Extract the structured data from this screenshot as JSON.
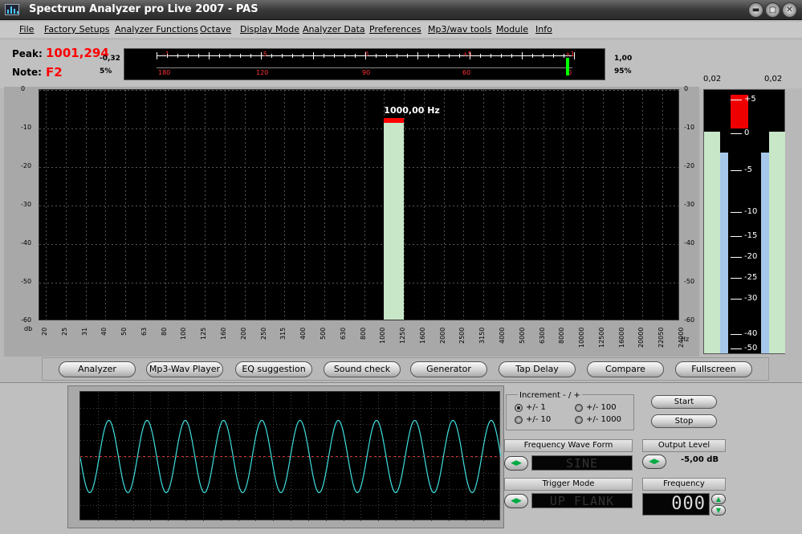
{
  "window": {
    "title": "Spectrum Analyzer pro Live 2007 - PAS",
    "controls": {
      "minimize": "▬",
      "restore": "▢",
      "close": "✕"
    }
  },
  "menu": [
    "File",
    "Factory Setups",
    "Analyzer Functions",
    "Octave",
    "Display Mode",
    "Analyzer Data",
    "Preferences",
    "Mp3/wav tools",
    "Module",
    "Info"
  ],
  "readout": {
    "peak_label": "Peak:",
    "peak_value": "1001,294",
    "note_label": "Note:",
    "note_value": "F2",
    "left_top": "-0,32",
    "left_bottom": "5%",
    "right_top": "1,00",
    "right_bottom": "95%"
  },
  "tuner": {
    "top_ticks": [
      "-1",
      "-5",
      "0",
      "+5",
      "+1"
    ],
    "bottom_ticks": [
      "180",
      "120",
      "90",
      "60",
      "0"
    ],
    "needle_fraction": 0.92
  },
  "spectrum": {
    "y_ticks": [
      "0",
      "-10",
      "-20",
      "-30",
      "-40",
      "-50",
      "-60"
    ],
    "y_unit": "db",
    "x_unit": "Hz",
    "x_ticks": [
      "20",
      "25",
      "31",
      "40",
      "50",
      "63",
      "80",
      "100",
      "125",
      "160",
      "200",
      "250",
      "315",
      "400",
      "500",
      "630",
      "800",
      "1000",
      "1250",
      "1600",
      "2000",
      "2500",
      "3150",
      "4000",
      "5000",
      "6300",
      "8000",
      "10000",
      "12500",
      "16000",
      "20000",
      "22050",
      "24000"
    ],
    "peak_label": "1000,00 Hz",
    "peak_db": -8.5
  },
  "vu": {
    "left_label": "0,02",
    "right_label": "0,02",
    "scale": [
      "+5",
      "0",
      "-5",
      "-10",
      "-15",
      "-20",
      "-25",
      "-30",
      "-40",
      "-50"
    ]
  },
  "buttons": [
    "Analyzer",
    "Mp3-Wav Player",
    "EQ suggestion",
    "Sound check",
    "Generator",
    "Tap Delay",
    "Compare",
    "Fullscreen"
  ],
  "generator": {
    "increment_title": "Increment - / +",
    "increments": [
      "+/- 1",
      "+/- 10",
      "+/- 100",
      "+/- 1000"
    ],
    "start": "Start",
    "stop": "Stop",
    "wave_form_title": "Frequency Wave Form",
    "wave_form": "SINE",
    "output_title": "Output Level",
    "output_value": "-5,00 dB",
    "trigger_title": "Trigger Mode",
    "trigger": "UP FLANK",
    "frequency_title": "Frequency",
    "frequency_display": "000",
    "cycles": 11
  },
  "colors": {
    "peak_red": "#ff0000",
    "bar_fill": "#c8e6c8",
    "scope_wave": "#40e0e0",
    "needle": "#00ff00"
  }
}
